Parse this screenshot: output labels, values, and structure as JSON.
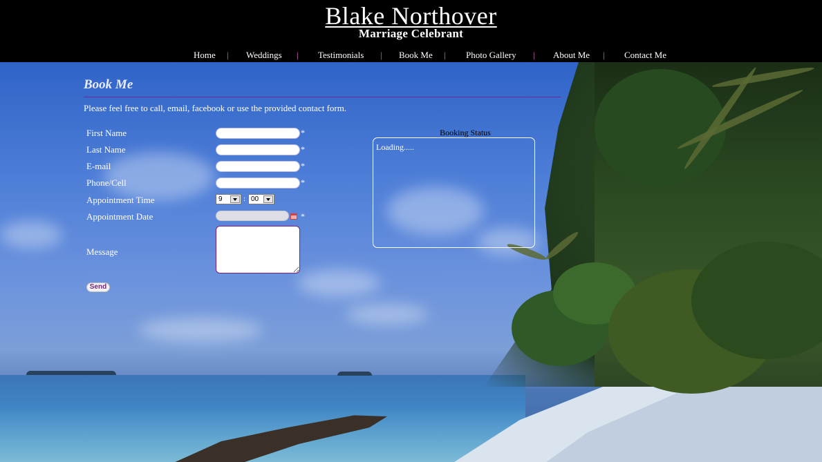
{
  "header": {
    "title": "Blake Northover",
    "subtitle": "Marriage Celebrant"
  },
  "nav": {
    "items": [
      "Home",
      "Weddings",
      "Testimonials",
      "Book Me",
      "Photo Gallery",
      "About Me",
      "Contact Me"
    ],
    "separator": "|"
  },
  "page": {
    "heading": "Book Me",
    "intro": "Please feel free to call, email, facebook or use the provided contact form."
  },
  "form": {
    "fields": {
      "first_name": "First Name",
      "last_name": "Last Name",
      "email": "E-mail",
      "phone": "Phone/Cell",
      "time": "Appointment Time",
      "date": "Appointment Date",
      "message": "Message"
    },
    "required_mark": "*",
    "time_hour": "9",
    "time_minute": "00",
    "time_separator": ":",
    "send_label": "Send"
  },
  "booking": {
    "title": "Booking Status",
    "status": "Loading....."
  },
  "colors": {
    "separator": "#e070c8",
    "heading_rule": "#6a2a9a",
    "message_border": "#7a1f7a"
  }
}
